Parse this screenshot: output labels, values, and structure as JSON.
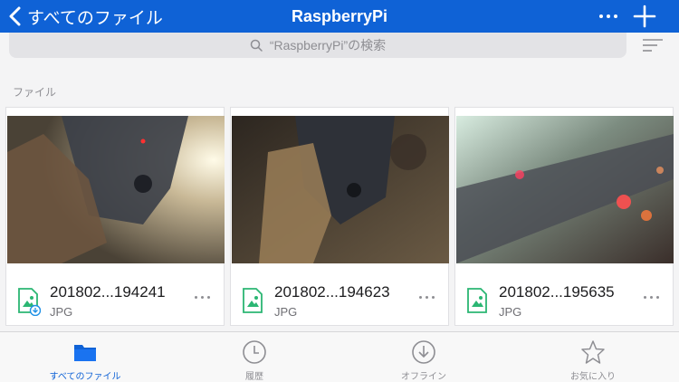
{
  "header": {
    "back_label": "すべてのファイル",
    "title": "RaspberryPi"
  },
  "search": {
    "placeholder": "“RaspberryPi”の検索"
  },
  "section": {
    "label": "ファイル"
  },
  "files": [
    {
      "name": "201802...194241",
      "type": "JPG",
      "offline": true
    },
    {
      "name": "201802...194623",
      "type": "JPG",
      "offline": false
    },
    {
      "name": "201802...195635",
      "type": "JPG",
      "offline": false
    }
  ],
  "tabs": [
    {
      "label": "すべてのファイル",
      "icon": "folder-icon",
      "active": true
    },
    {
      "label": "履歴",
      "icon": "clock-icon",
      "active": false
    },
    {
      "label": "オフライン",
      "icon": "download-circle-icon",
      "active": false
    },
    {
      "label": "お気に入り",
      "icon": "star-icon",
      "active": false
    }
  ],
  "colors": {
    "accent": "#0f62d6",
    "file_icon": "#2bb673"
  }
}
